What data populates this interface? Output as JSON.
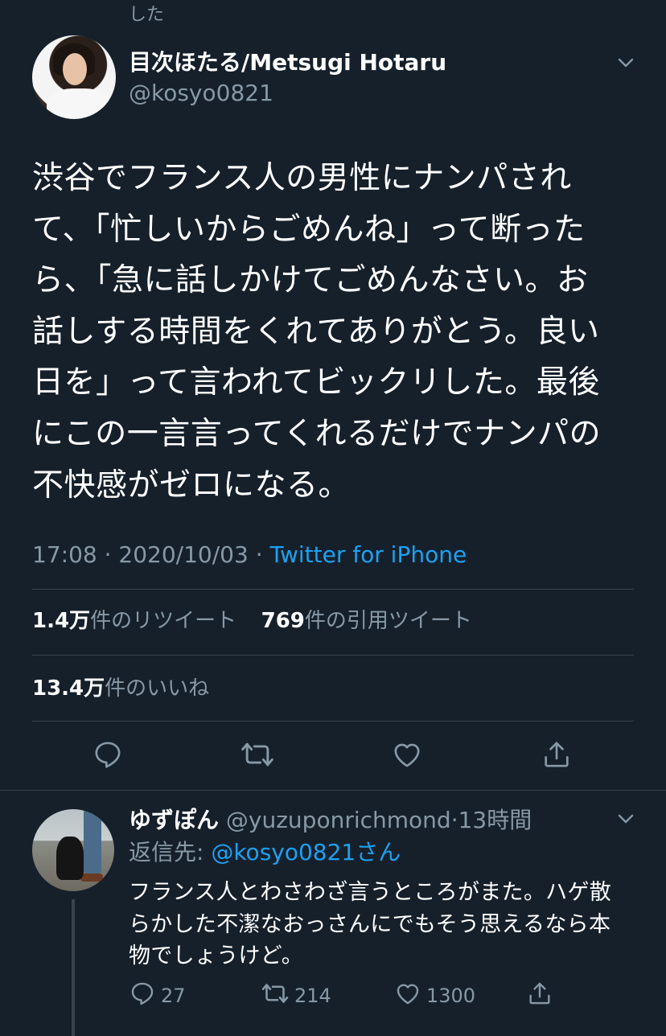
{
  "header": {
    "truncated_text": "した"
  },
  "tweet": {
    "author_name": "目次ほたる/Metsugi Hotaru",
    "author_handle": "@kosyo0821",
    "text": "渋谷でフランス人の男性にナンパされ\nて、「忙しいからごめんね」って断った\nら、「急に話しかけてごめんなさい。お\n話しする時間をくれてありがとう。良い\n日を」って言われてビックリした。最後\nにこの一言言ってくれるだけでナンパの\n不快感がゼロになる。",
    "time": "17:08",
    "date": "2020/10/03",
    "separator": "·",
    "source": "Twitter for iPhone",
    "retweets_count": "1.4万",
    "retweets_label": "件のリツイート",
    "quotes_count": "769",
    "quotes_label": "件の引用ツイート",
    "likes_count": "13.4万",
    "likes_label": "件のいいね"
  },
  "reply": {
    "author_name": "ゆずぽん",
    "author_handle": "@yuzuponrichmond",
    "time": "13時間",
    "separator": "·",
    "reply_to_label": "返信先:",
    "reply_to_handle": "@kosyo0821さん",
    "text": "フランス人とわさわざ言うところがまた。ハゲ散\nらかした不潔なおっさんにでもそう思えるなら本\n物でしょうけど。",
    "reply_count": "27",
    "retweet_count": "214",
    "like_count": "1300"
  },
  "icons": {
    "chevron": "chevron-down-icon",
    "reply": "reply-icon",
    "retweet": "retweet-icon",
    "like": "heart-icon",
    "share": "share-icon"
  },
  "colors": {
    "background": "#15202b",
    "text": "#ffffff",
    "muted": "#8899a6",
    "link": "#1da1f2",
    "divider": "#38444d"
  }
}
